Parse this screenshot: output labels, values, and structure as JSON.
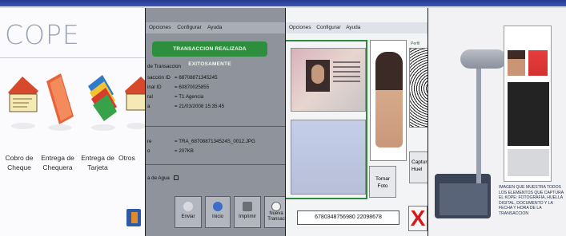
{
  "colors": {
    "header_stripe": "#263a8c",
    "success_banner": "#2d8f3e",
    "close_button": "#d21b1b",
    "capture_frame": "#2c8a3a"
  },
  "panel1": {
    "logo_text": "COPE",
    "options": [
      {
        "label": "Cobro de Cheque",
        "icon": "cheque-icon"
      },
      {
        "label": "Entrega de Chequera",
        "icon": "checkbook-icon"
      },
      {
        "label": "Entrega de Tarjeta",
        "icon": "cards-icon"
      },
      {
        "label": "Otros",
        "icon": "other-icon"
      }
    ]
  },
  "panel2": {
    "menu": [
      "Opciones",
      "Configurar",
      "Ayuda"
    ],
    "banner": "TRANSACCION REALIZADA EXITOSAMENTE",
    "section_title": "de Transaccion",
    "fields": [
      {
        "key": "sacción ID",
        "value": "= 68708871345245"
      },
      {
        "key": "inal ID",
        "value": "= 60870025855"
      },
      {
        "key": "ral",
        "value": "= T1 Agencia"
      },
      {
        "key": "a",
        "value": "= 21/03/2008 15:35:45"
      }
    ],
    "file_fields": [
      {
        "key": "re",
        "value": "= TRA_6870887134524S_0012.JPG"
      },
      {
        "key": "o",
        "value": "= 207KB"
      }
    ],
    "watermark_label": "a de Agua",
    "buttons": [
      {
        "label": "Enviar",
        "icon": "send-icon"
      },
      {
        "label": "Inicio",
        "icon": "home-icon"
      },
      {
        "label": "Imprimir",
        "icon": "print-icon"
      },
      {
        "label": "Nueva Transac",
        "icon": "new-icon"
      }
    ]
  },
  "panel3": {
    "menu": [
      "Opciones",
      "Configurar",
      "Ayuda"
    ],
    "profile_label": "Perfil",
    "take_photo": "Tomar Foto",
    "capture": "Captura Huel",
    "close": "X",
    "barcode": "6780348756980 22098678"
  },
  "panel4": {
    "caption": "IMAGEN QUE MUESTRA TODOS LOS ELEMENTOS QUE CAPTURA EL KOPE: FOTOGRAFIA, HUELLA DIGITAL, DOCUMENTO Y LA FECHA Y HORA DE LA TRANSACCION"
  }
}
